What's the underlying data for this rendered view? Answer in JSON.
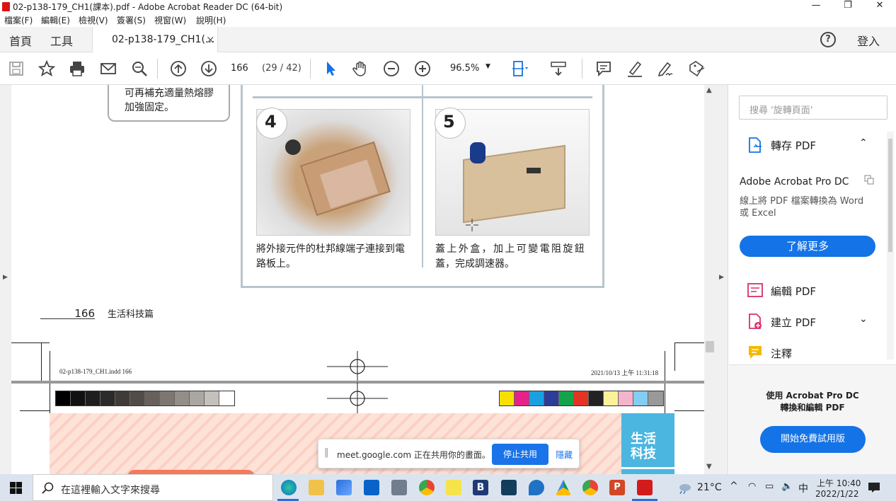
{
  "window": {
    "title": "02-p138-179_CH1(課本).pdf - Adobe Acrobat Reader DC (64-bit)"
  },
  "menu": [
    "檔案(F)",
    "編輯(E)",
    "檢視(V)",
    "簽署(S)",
    "視窗(W)",
    "說明(H)"
  ],
  "tabs": {
    "home": "首頁",
    "tools": "工具",
    "doc": "02-p138-179_CH1(...",
    "close": "×",
    "signin": "登入"
  },
  "toolbar": {
    "page_number": "166",
    "page_count": "(29 / 42)",
    "zoom": "96.5%"
  },
  "document": {
    "note_line1": "可再補充適量熱熔膠",
    "note_line2": "加強固定。",
    "step4_num": "4",
    "step4_line1": "將外接元件的杜邦線端子連接到電",
    "step4_line2": "路板上。",
    "step5_num": "5",
    "step5_line1": "蓋上外盒，加上可變電阻旋鈕",
    "step5_line2": "蓋，完成調速器。",
    "page_num": "166",
    "page_section": "生活科技篇",
    "slug_file": "02-p138-179_CH1.indd 166",
    "slug_date": "2021/10/13 上午 11:31:18",
    "badge_line1": "生活",
    "badge_line2": "科技"
  },
  "share_bar": {
    "text": "meet.google.com 正在共用你的畫面。",
    "stop": "停止共用",
    "hide": "隱藏"
  },
  "side_panel": {
    "search_placeholder": "搜尋 '旋轉頁面'",
    "export_pdf": "轉存 PDF",
    "product": "Adobe Acrobat Pro DC",
    "desc": "線上將 PDF 檔案轉換為 Word 或 Excel",
    "learn_more": "了解更多",
    "edit_pdf": "編輯 PDF",
    "create_pdf": "建立 PDF",
    "comment": "注釋",
    "promo_line1": "使用 Acrobat Pro DC",
    "promo_line2": "轉換和編輯 PDF",
    "trial": "開始免費試用版"
  },
  "taskbar": {
    "search_placeholder": "在這裡輸入文字來搜尋",
    "temp": "21°C",
    "ime": "中",
    "time": "上午 10:40",
    "date": "2022/1/22"
  },
  "colors": {
    "accent": "#1473e6",
    "frame": "#b8c4cc",
    "stripe": "#fbd0c2",
    "badge": "#4bb6e0"
  }
}
